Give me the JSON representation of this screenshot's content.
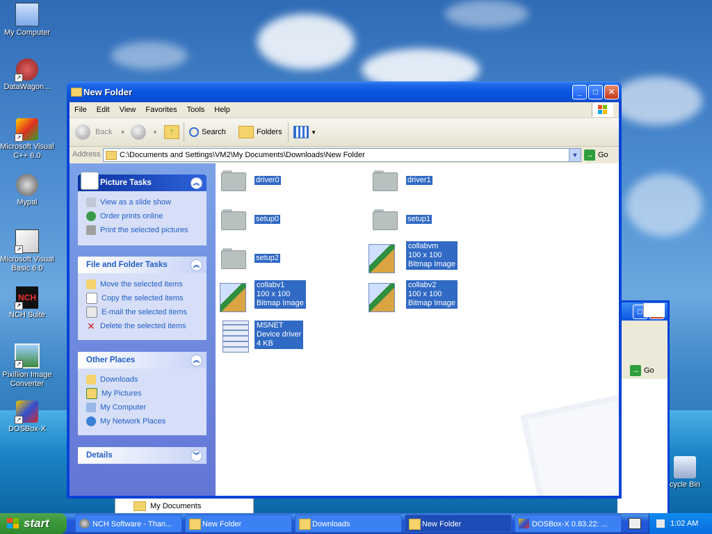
{
  "desktop": {
    "icons": [
      {
        "label": "My Computer"
      },
      {
        "label": "DataWagon..."
      },
      {
        "label": "Microsoft Visual C++ 6.0"
      },
      {
        "label": "Mypal"
      },
      {
        "label": "Microsoft Visual Basic 6.0"
      },
      {
        "label": "NCH Suite"
      },
      {
        "label": "Pixillion Image Converter"
      },
      {
        "label": "DOSBox-X"
      },
      {
        "label": "cycle Bin"
      }
    ],
    "background_window": {
      "go_label": "Go"
    },
    "behind_item": "My Documents"
  },
  "window": {
    "title": "New Folder",
    "menu": [
      "File",
      "Edit",
      "View",
      "Favorites",
      "Tools",
      "Help"
    ],
    "toolbar": {
      "back": "Back",
      "search": "Search",
      "folders": "Folders"
    },
    "address": {
      "label": "Address",
      "value": "C:\\Documents and Settings\\VM2\\My Documents\\Downloads\\New Folder",
      "go": "Go"
    },
    "panels": {
      "picture_tasks": {
        "title": "Picture Tasks",
        "items": [
          "View as a slide show",
          "Order prints online",
          "Print the selected pictures"
        ]
      },
      "file_tasks": {
        "title": "File and Folder Tasks",
        "items": [
          "Move the selected items",
          "Copy the selected items",
          "E-mail the selected items",
          "Delete the selected items"
        ]
      },
      "other_places": {
        "title": "Other Places",
        "items": [
          "Downloads",
          "My Pictures",
          "My Computer",
          "My Network Places"
        ]
      },
      "details": {
        "title": "Details"
      }
    },
    "files": [
      {
        "name": "driver0"
      },
      {
        "name": "driver1"
      },
      {
        "name": "setup0"
      },
      {
        "name": "setup1"
      },
      {
        "name": "setup2"
      },
      {
        "name": "collabvm",
        "l2": "100 x 100",
        "l3": "Bitmap Image"
      },
      {
        "name": "collabv1",
        "l2": "100 x 100",
        "l3": "Bitmap Image"
      },
      {
        "name": "collabv2",
        "l2": "100 x 100",
        "l3": "Bitmap Image"
      },
      {
        "name": "MSNET",
        "l2": "Device driver",
        "l3": "4 KB"
      }
    ]
  },
  "taskbar": {
    "start": "start",
    "tasks": [
      "NCH Software - Than...",
      "New Folder",
      "Downloads",
      "New Folder",
      "DOSBox-X 0.83.22: ..."
    ],
    "clock": "1:02 AM"
  },
  "colors": {
    "selection": "#316ac5",
    "link": "#215dc6",
    "title_blue": "#0b56e0"
  }
}
